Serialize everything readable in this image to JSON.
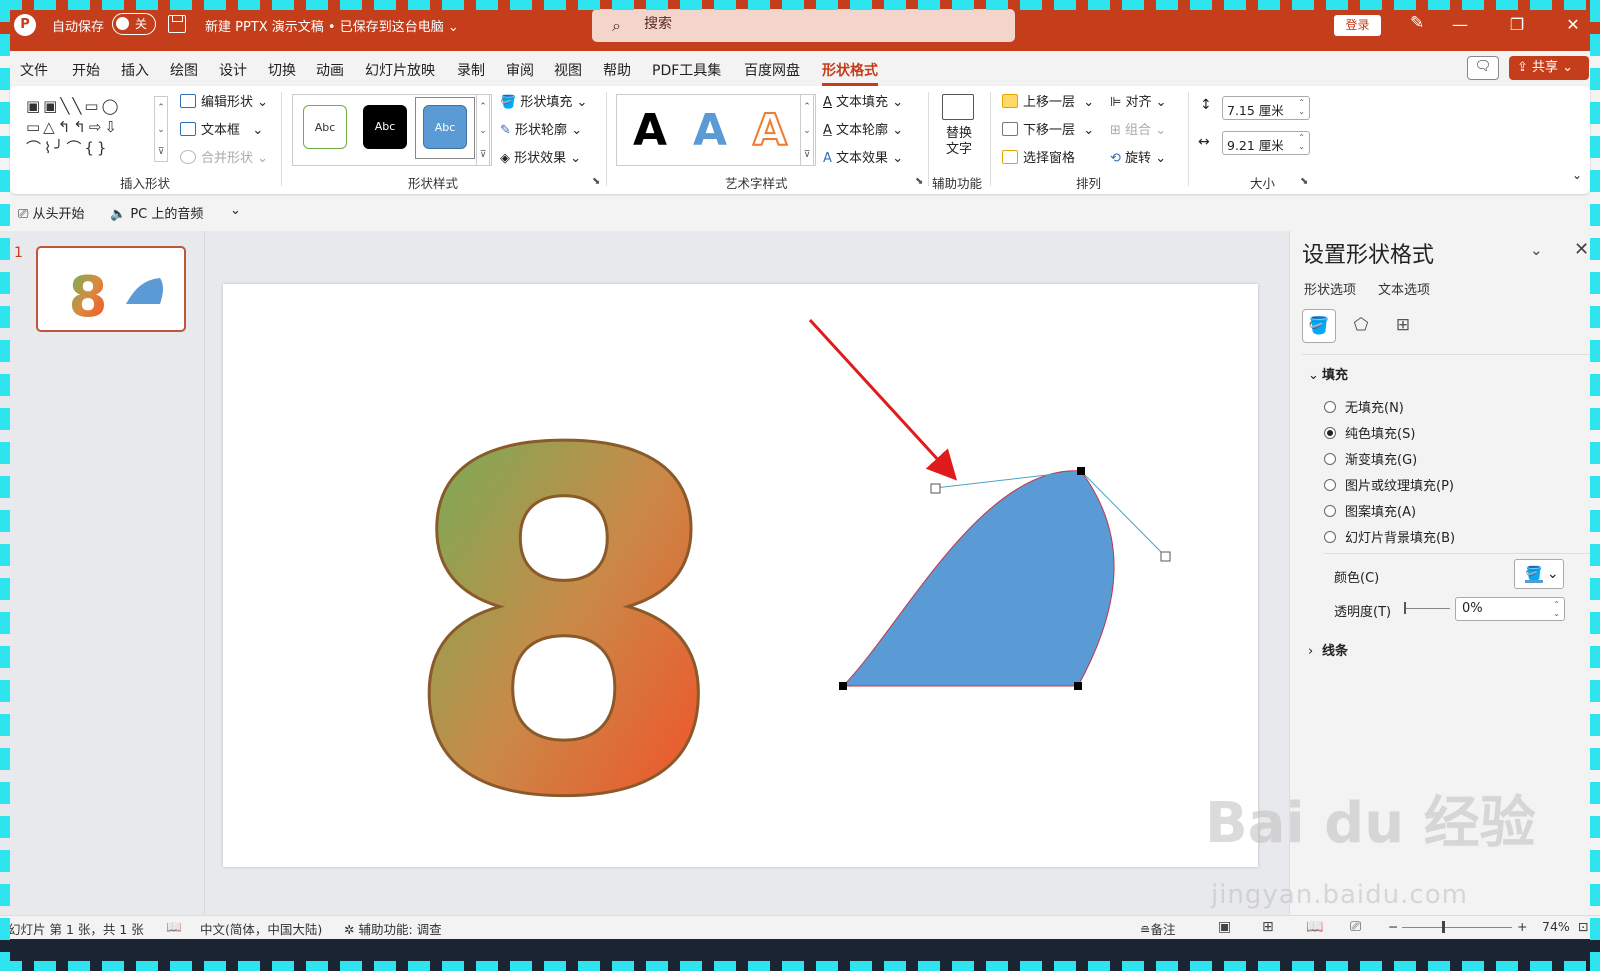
{
  "titlebar": {
    "app_icon": "powerpoint-logo-icon",
    "autosave_label": "自动保存",
    "autosave_state": "关",
    "doc_title": "新建 PPTX 演示文稿 • 已保存到这台电脑 ⌄",
    "search_placeholder": "搜索",
    "login_label": "登录",
    "window_buttons": [
      "—",
      "❐",
      "✕"
    ]
  },
  "menubar": {
    "items": [
      "文件",
      "开始",
      "插入",
      "绘图",
      "设计",
      "切换",
      "动画",
      "幻灯片放映",
      "录制",
      "审阅",
      "视图",
      "帮助",
      "PDF工具集",
      "百度网盘",
      "形状格式"
    ],
    "active": "形状格式",
    "share_label": "共享"
  },
  "ribbon": {
    "insert_shapes": {
      "label": "插入形状",
      "edit_shape": "编辑形状",
      "text_box": "文本框",
      "merge_shapes": "合并形状"
    },
    "shape_styles": {
      "label": "形状样式",
      "swatches": [
        "Abc",
        "Abc",
        "Abc"
      ],
      "fill": "形状填充",
      "outline": "形状轮廓",
      "effects": "形状效果"
    },
    "wordart": {
      "label": "艺术字样式",
      "letters": [
        "A",
        "A",
        "A"
      ],
      "text_fill": "文本填充",
      "text_outline": "文本轮廓",
      "text_effects": "文本效果"
    },
    "accessibility": {
      "label": "辅助功能",
      "alt_text_line1": "替换",
      "alt_text_line2": "文字"
    },
    "arrange": {
      "label": "排列",
      "bring_forward": "上移一层",
      "send_backward": "下移一层",
      "selection_pane": "选择窗格",
      "align": "对齐",
      "group": "组合",
      "rotate": "旋转"
    },
    "size": {
      "label": "大小",
      "height": "7.15 厘米",
      "width": "9.21 厘米"
    }
  },
  "qat": {
    "from_start": "从头开始",
    "pc_audio": "PC 上的音频"
  },
  "slides": {
    "current_number": "1",
    "thumb_digit": "8",
    "big_digit": "8"
  },
  "format_pane": {
    "title": "设置形状格式",
    "tabs": [
      "形状选项",
      "文本选项"
    ],
    "fill_section": "填充",
    "fill_options": [
      "无填充(N)",
      "纯色填充(S)",
      "渐变填充(G)",
      "图片或纹理填充(P)",
      "图案填充(A)",
      "幻灯片背景填充(B)"
    ],
    "selected_fill": "纯色填充(S)",
    "color_label": "颜色(C)",
    "transparency_label": "透明度(T)",
    "transparency_value": "0%",
    "line_section": "线条"
  },
  "statusbar": {
    "slide_info": "幻灯片 第 1 张，共 1 张",
    "language": "中文(简体，中国大陆)",
    "accessibility": "辅助功能: 调查",
    "notes": "备注",
    "zoom": "74%"
  },
  "watermark": {
    "logo": "Bai du 经验",
    "url": "jingyan.baidu.com"
  },
  "colors": {
    "accent": "#c43e1c",
    "shape_fill": "#5b9bd5",
    "arrow": "#e01b1b"
  }
}
